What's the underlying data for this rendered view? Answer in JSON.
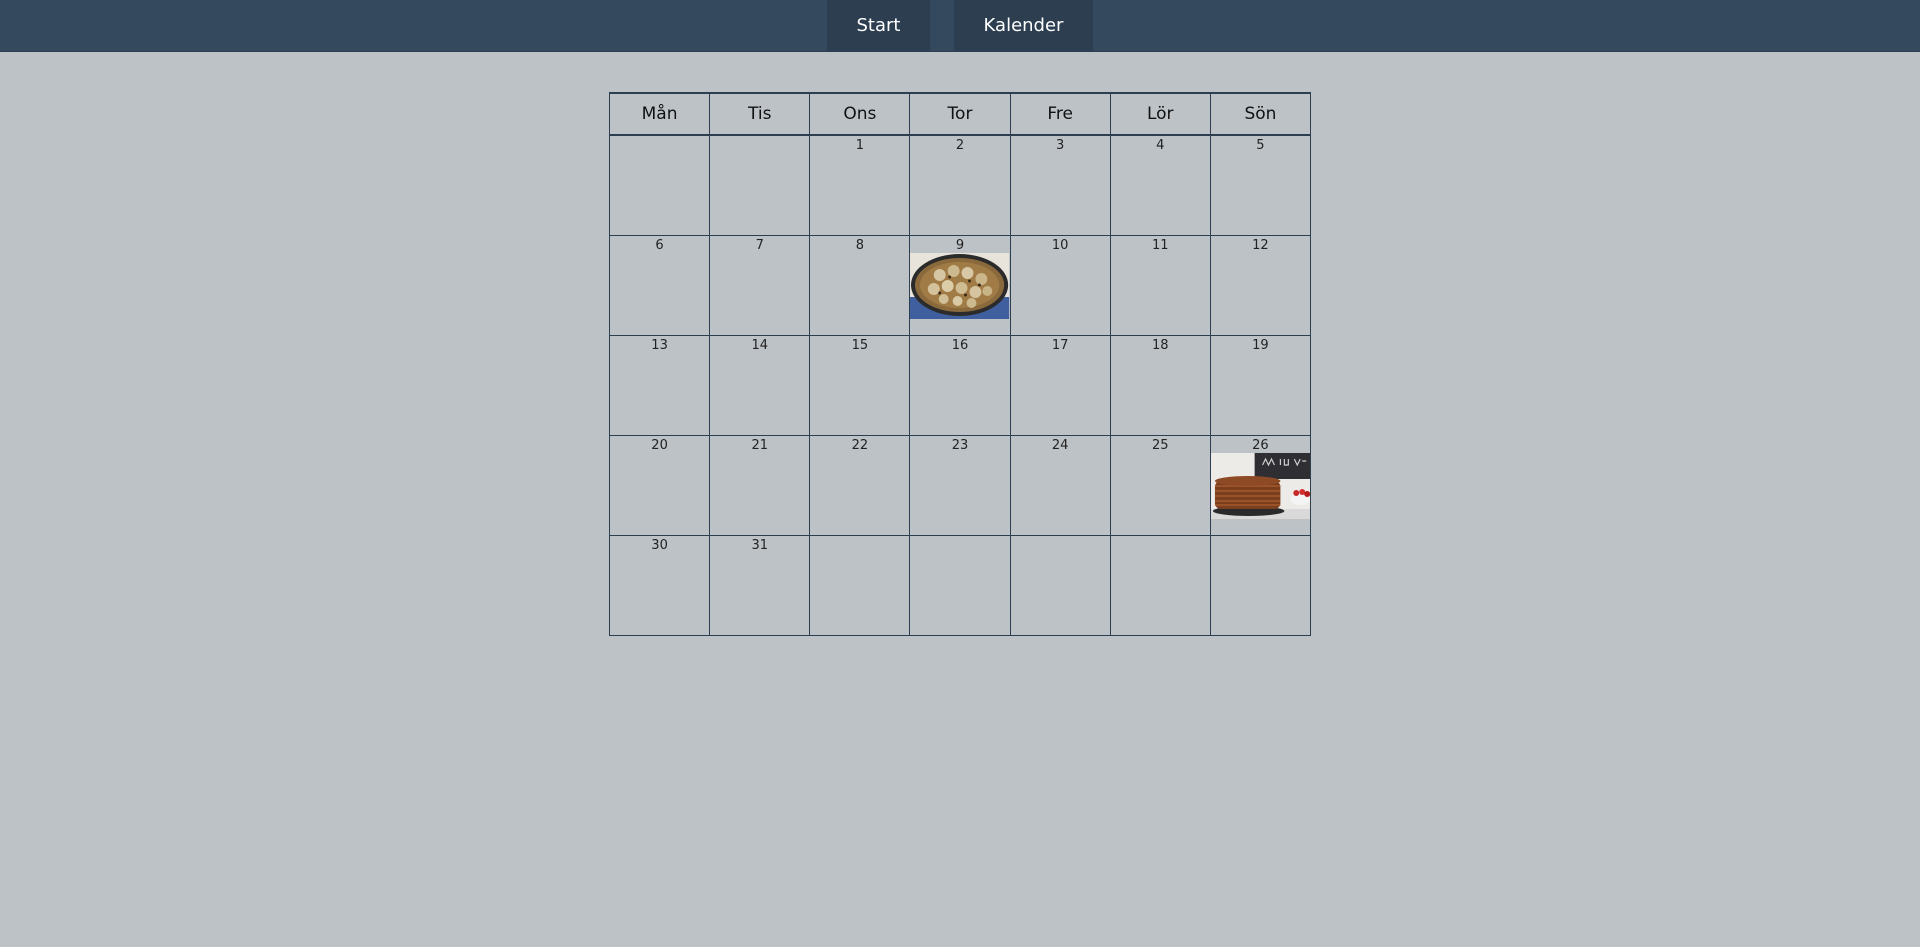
{
  "nav": {
    "start_label": "Start",
    "calendar_label": "Kalender"
  },
  "calendar": {
    "weekdays": [
      "Mån",
      "Tis",
      "Ons",
      "Tor",
      "Fre",
      "Lör",
      "Sön"
    ],
    "weeks": [
      [
        "",
        "",
        "1",
        "2",
        "3",
        "4",
        "5"
      ],
      [
        "6",
        "7",
        "8",
        "9",
        "10",
        "11",
        "12"
      ],
      [
        "13",
        "14",
        "15",
        "16",
        "17",
        "18",
        "19"
      ],
      [
        "20",
        "21",
        "22",
        "23",
        "24",
        "25",
        "26"
      ],
      [
        "30",
        "31",
        "",
        "",
        "",
        "",
        ""
      ]
    ],
    "meals": [
      {
        "day": "9",
        "image": "meatballs-in-pan-photo"
      },
      {
        "day": "26",
        "image": "pancake-stack-photo"
      }
    ]
  },
  "colors": {
    "background": "#bdc2c6",
    "topbar": "#34495e",
    "tab": "#2c3e50",
    "grid": "#2c3e50"
  }
}
